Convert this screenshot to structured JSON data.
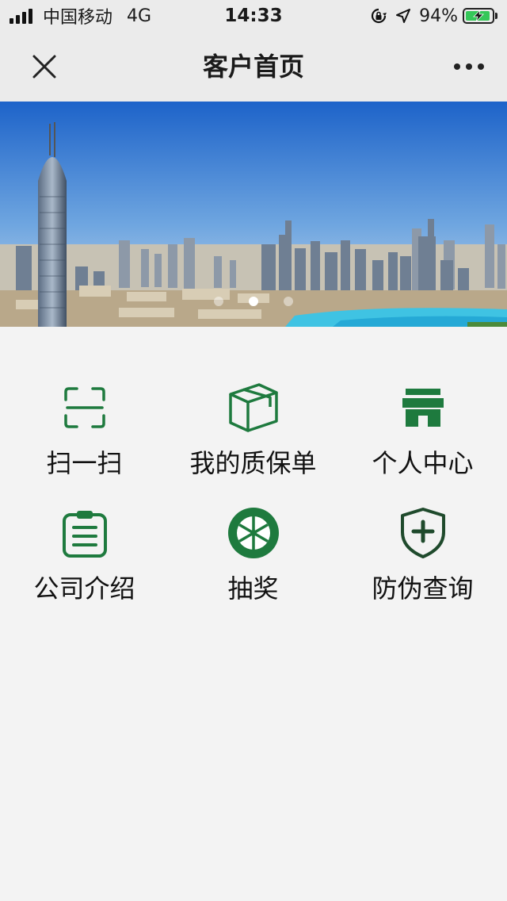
{
  "status_bar": {
    "carrier": "中国移动",
    "network": "4G",
    "time": "14:33",
    "battery_percent": "94%",
    "battery_level": 0.94,
    "battery_color": "#35c759"
  },
  "nav": {
    "title": "客户首页",
    "close_icon": "close-icon",
    "more_icon": "more-icon"
  },
  "banner": {
    "slide_count": 3,
    "active_slide": 2
  },
  "colors": {
    "accent": "#1e7a3e",
    "background": "#f3f3f3",
    "bar": "#ebebeb"
  },
  "menu": [
    {
      "label": "扫一扫",
      "icon": "scan-icon"
    },
    {
      "label": "我的质保单",
      "icon": "box-icon"
    },
    {
      "label": "个人中心",
      "icon": "store-icon"
    },
    {
      "label": "公司介绍",
      "icon": "clipboard-icon"
    },
    {
      "label": "抽奖",
      "icon": "lottery-wheel-icon"
    },
    {
      "label": "防伪查询",
      "icon": "shield-plus-icon"
    }
  ]
}
